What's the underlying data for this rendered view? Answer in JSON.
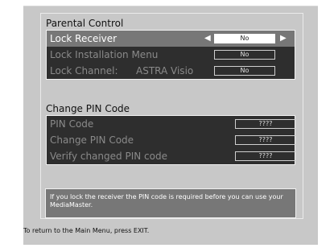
{
  "parental_control": {
    "title": "Parental Control",
    "rows": [
      {
        "label": "Lock Receiver",
        "value": "No",
        "selected": true
      },
      {
        "label": "Lock Installation Menu",
        "value": "No"
      },
      {
        "label": "Lock Channel:",
        "sublabel": "ASTRA Visio",
        "value": "No"
      }
    ]
  },
  "change_pin": {
    "title": "Change PIN Code",
    "rows": [
      {
        "label": "PIN Code",
        "value": "????"
      },
      {
        "label": "Change PIN Code",
        "value": "????"
      },
      {
        "label": "Verify changed PIN code",
        "value": "????"
      }
    ]
  },
  "info": {
    "message": "If you lock the receiver the PIN code is required before you can use your MediaMaster."
  },
  "footer": {
    "exit_hint": "To return to the Main Menu, press EXIT."
  },
  "icons": {
    "left_arrow": "◀",
    "right_arrow": "▶"
  },
  "colors": {
    "screen_bg": "#c8c8c8",
    "block_bg": "#2e2e2e",
    "selected_row": "#777777",
    "info_bg": "#777777"
  }
}
